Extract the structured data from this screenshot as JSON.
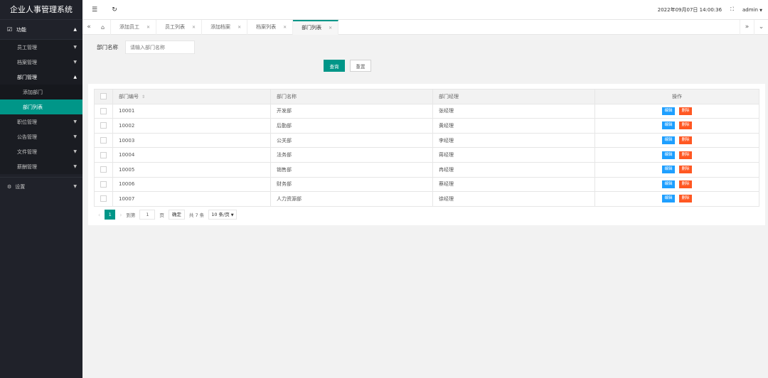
{
  "app": {
    "title": "企业人事管理系统"
  },
  "sidebar": {
    "top": {
      "label": "功能"
    },
    "items": [
      {
        "label": "员工管理"
      },
      {
        "label": "档案管理"
      },
      {
        "label": "部门管理"
      },
      {
        "label": "职位管理"
      },
      {
        "label": "公告管理"
      },
      {
        "label": "文件管理"
      },
      {
        "label": "薪酬管理"
      }
    ],
    "dept_sub": [
      {
        "label": "添加部门"
      },
      {
        "label": "部门列表"
      }
    ],
    "settings": {
      "label": "设置"
    }
  },
  "header": {
    "datetime": "2022年09月07日 14:00:36",
    "user": "admin"
  },
  "tabs": [
    {
      "label": "添加员工"
    },
    {
      "label": "员工列表"
    },
    {
      "label": "添加档案"
    },
    {
      "label": "档案列表"
    },
    {
      "label": "部门列表"
    }
  ],
  "search": {
    "label": "部门名称",
    "placeholder": "请输入部门名称",
    "query_label": "查询",
    "reset_label": "重置"
  },
  "table": {
    "headers": [
      "部门编号",
      "部门名称",
      "部门经理",
      "操作"
    ],
    "edit_label": "编辑",
    "delete_label": "删除",
    "rows": [
      {
        "id": "10001",
        "name": "开发部",
        "manager": "张经理"
      },
      {
        "id": "10002",
        "name": "后勤部",
        "manager": "黄经理"
      },
      {
        "id": "10003",
        "name": "公关部",
        "manager": "李经理"
      },
      {
        "id": "10004",
        "name": "法务部",
        "manager": "蒋经理"
      },
      {
        "id": "10005",
        "name": "销售部",
        "manager": "冉经理"
      },
      {
        "id": "10006",
        "name": "财务部",
        "manager": "蔡经理"
      },
      {
        "id": "10007",
        "name": "人力资源部",
        "manager": "徐经理"
      }
    ]
  },
  "pager": {
    "current": "1",
    "goto_label": "到第",
    "page_input": "1",
    "page_unit": "页",
    "confirm": "确定",
    "total": "共 7 条",
    "page_size": "10 条/页"
  },
  "colors": {
    "accent": "#009688",
    "sidebar": "#20222a",
    "edit": "#1e9fff",
    "delete": "#ff5722"
  }
}
